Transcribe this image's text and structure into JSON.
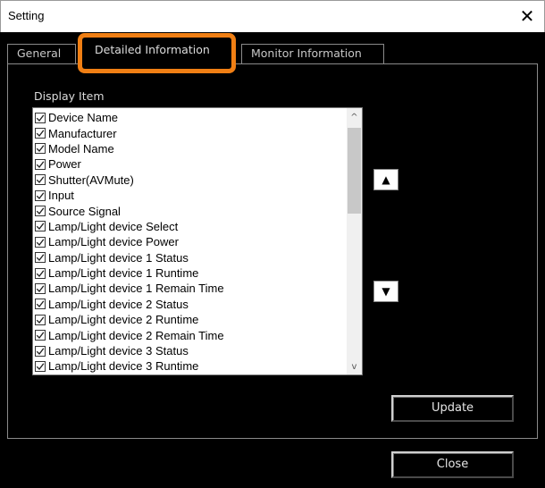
{
  "window": {
    "title": "Setting",
    "close_glyph": "✕"
  },
  "tabs": [
    {
      "label": "General",
      "active": false
    },
    {
      "label": "Detailed Information",
      "active": true
    },
    {
      "label": "Monitor Information",
      "active": false
    }
  ],
  "highlight_color": "#f07f14",
  "display_item": {
    "label": "Display Item",
    "items": [
      {
        "label": "Device Name",
        "checked": true
      },
      {
        "label": "Manufacturer",
        "checked": true
      },
      {
        "label": "Model Name",
        "checked": true
      },
      {
        "label": "Power",
        "checked": true
      },
      {
        "label": "Shutter(AVMute)",
        "checked": true
      },
      {
        "label": "Input",
        "checked": true
      },
      {
        "label": "Source Signal",
        "checked": true
      },
      {
        "label": "Lamp/Light device Select",
        "checked": true
      },
      {
        "label": "Lamp/Light device Power",
        "checked": true
      },
      {
        "label": "Lamp/Light device 1 Status",
        "checked": true
      },
      {
        "label": "Lamp/Light device 1 Runtime",
        "checked": true
      },
      {
        "label": "Lamp/Light device 1 Remain Time",
        "checked": true
      },
      {
        "label": "Lamp/Light device 2 Status",
        "checked": true
      },
      {
        "label": "Lamp/Light device 2 Runtime",
        "checked": true
      },
      {
        "label": "Lamp/Light device 2 Remain Time",
        "checked": true
      },
      {
        "label": "Lamp/Light device 3 Status",
        "checked": true
      },
      {
        "label": "Lamp/Light device 3 Runtime",
        "checked": true
      }
    ]
  },
  "buttons": {
    "move_up": "▲",
    "move_down": "▼",
    "update": "Update",
    "close": "Close"
  },
  "scrollbar": {
    "up_glyph": "^",
    "down_glyph": "v"
  }
}
